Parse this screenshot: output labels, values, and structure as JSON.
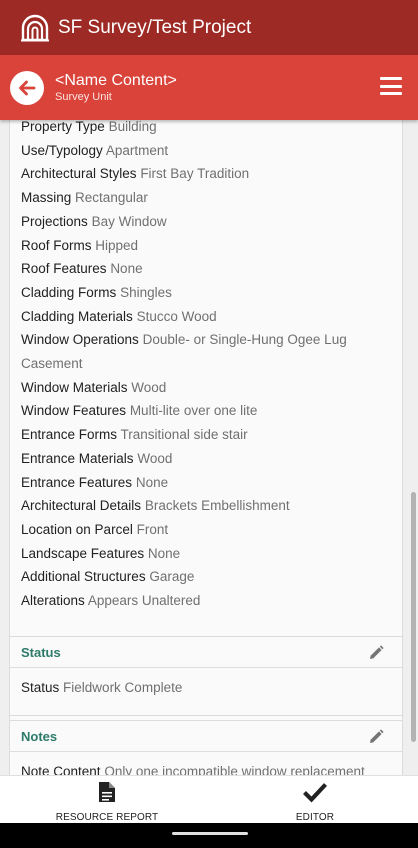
{
  "app": {
    "title": "SF Survey/Test Project"
  },
  "header": {
    "title": "<Name Content>",
    "caption": "Survey Unit"
  },
  "fields": [
    {
      "label": "Property Type",
      "value": "Building"
    },
    {
      "label": "Use/Typology",
      "value": "Apartment"
    },
    {
      "label": "Architectural Styles",
      "value": "First Bay Tradition"
    },
    {
      "label": "Massing",
      "value": "Rectangular"
    },
    {
      "label": "Projections",
      "value": "Bay Window"
    },
    {
      "label": "Roof Forms",
      "value": "Hipped"
    },
    {
      "label": "Roof Features",
      "value": "None"
    },
    {
      "label": "Cladding Forms",
      "value": "Shingles"
    },
    {
      "label": "Cladding Materials",
      "value": "Stucco Wood"
    },
    {
      "label": "Window Operations",
      "value": "Double- or Single-Hung Ogee Lug Casement"
    },
    {
      "label": "Window Materials",
      "value": "Wood"
    },
    {
      "label": "Window Features",
      "value": "Multi-lite over one lite"
    },
    {
      "label": "Entrance Forms",
      "value": "Transitional side stair"
    },
    {
      "label": "Entrance Materials",
      "value": "Wood"
    },
    {
      "label": "Entrance Features",
      "value": "None"
    },
    {
      "label": "Architectural Details",
      "value": "Brackets Embellishment"
    },
    {
      "label": "Location on Parcel",
      "value": "Front"
    },
    {
      "label": "Landscape Features",
      "value": "None"
    },
    {
      "label": "Additional Structures",
      "value": "Garage"
    },
    {
      "label": "Alterations",
      "value": "Appears Unaltered"
    }
  ],
  "status_section": {
    "title": "Status",
    "label": "Status",
    "value": "Fieldwork Complete"
  },
  "notes_section": {
    "title": "Notes",
    "label": "Note Content",
    "value": "Only one incompatible window replacement"
  },
  "bottom_nav": {
    "report_label": "RESOURCE REPORT",
    "editor_label": "EDITOR"
  },
  "colors": {
    "title_bar": "#9d2a24",
    "header_bar": "#d9433a",
    "section_title": "#2c7a6a"
  },
  "icons": {
    "logo": "arch-logo-icon",
    "back": "back-arrow-icon",
    "menu": "hamburger-menu-icon",
    "edit": "pencil-icon",
    "report": "document-icon",
    "editor": "checkmark-icon"
  }
}
